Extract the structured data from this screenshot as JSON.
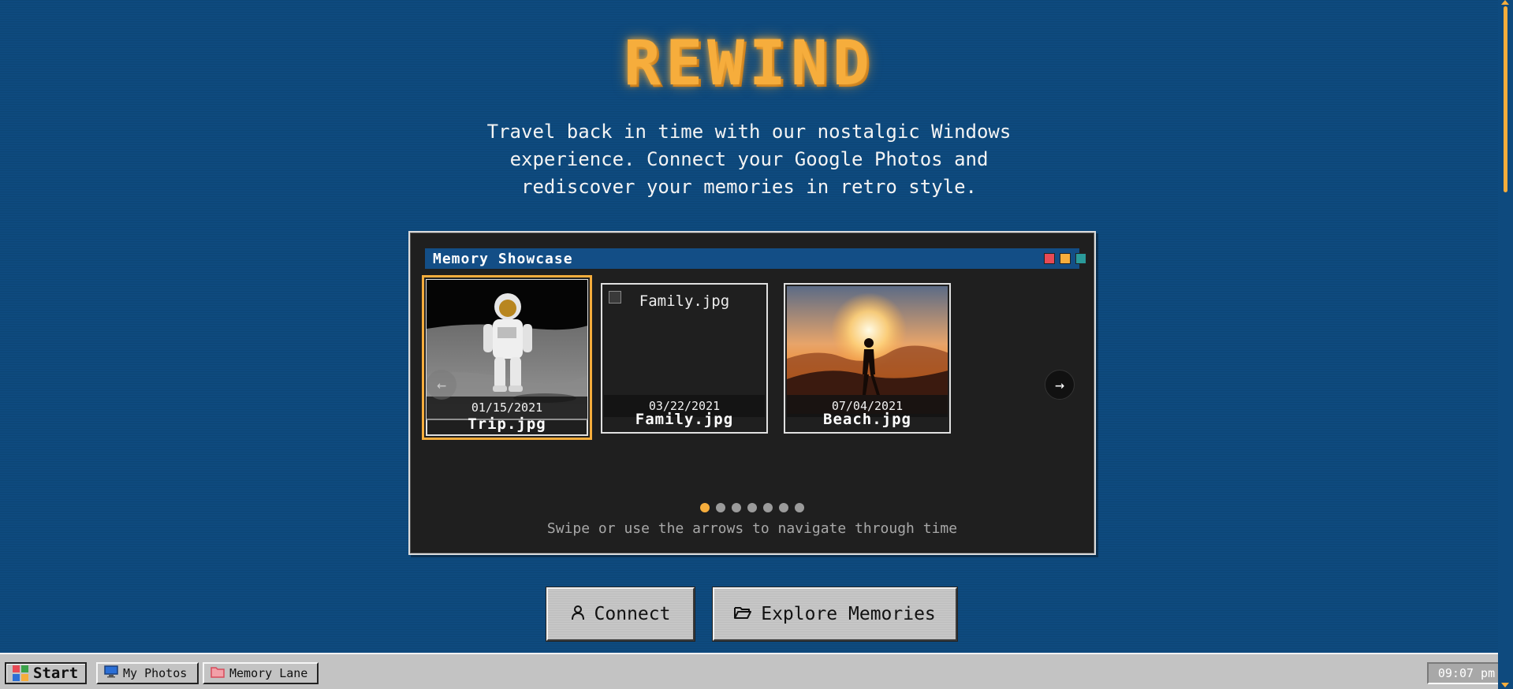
{
  "hero": {
    "title": "REWIND",
    "subtitle": "Travel back in time with our nostalgic Windows experience. Connect your Google Photos and rediscover your memories in retro style."
  },
  "showcase": {
    "window_title": "Memory Showcase",
    "cards": [
      {
        "name": "Trip.jpg",
        "date": "01/15/2021",
        "image": "astronaut-on-moon",
        "selected": true
      },
      {
        "name": "Family.jpg",
        "date": "03/22/2021",
        "image": "broken-image",
        "alt": "Family.jpg",
        "selected": false
      },
      {
        "name": "Beach.jpg",
        "date": "07/04/2021",
        "image": "sunset-silhouette",
        "selected": false
      }
    ],
    "prev_icon": "arrow-left-icon",
    "next_icon": "arrow-right-icon",
    "dots": {
      "count": 7,
      "active_index": 0
    },
    "hint": "Swipe or use the arrows to navigate through time"
  },
  "actions": {
    "connect_label": "Connect",
    "connect_icon": "user-icon",
    "explore_label": "Explore Memories",
    "explore_icon": "folder-open-icon"
  },
  "taskbar": {
    "start_label": "Start",
    "items": [
      {
        "label": "My Photos",
        "icon": "monitor-icon"
      },
      {
        "label": "Memory Lane",
        "icon": "folder-icon"
      }
    ],
    "clock": "09:07 pm"
  },
  "colors": {
    "background": "#0e4a7e",
    "accent": "#f6ad3c",
    "window_bg": "#1f1f1f",
    "titlebar": "#134e86",
    "taskbar": "#c3c3c3"
  }
}
